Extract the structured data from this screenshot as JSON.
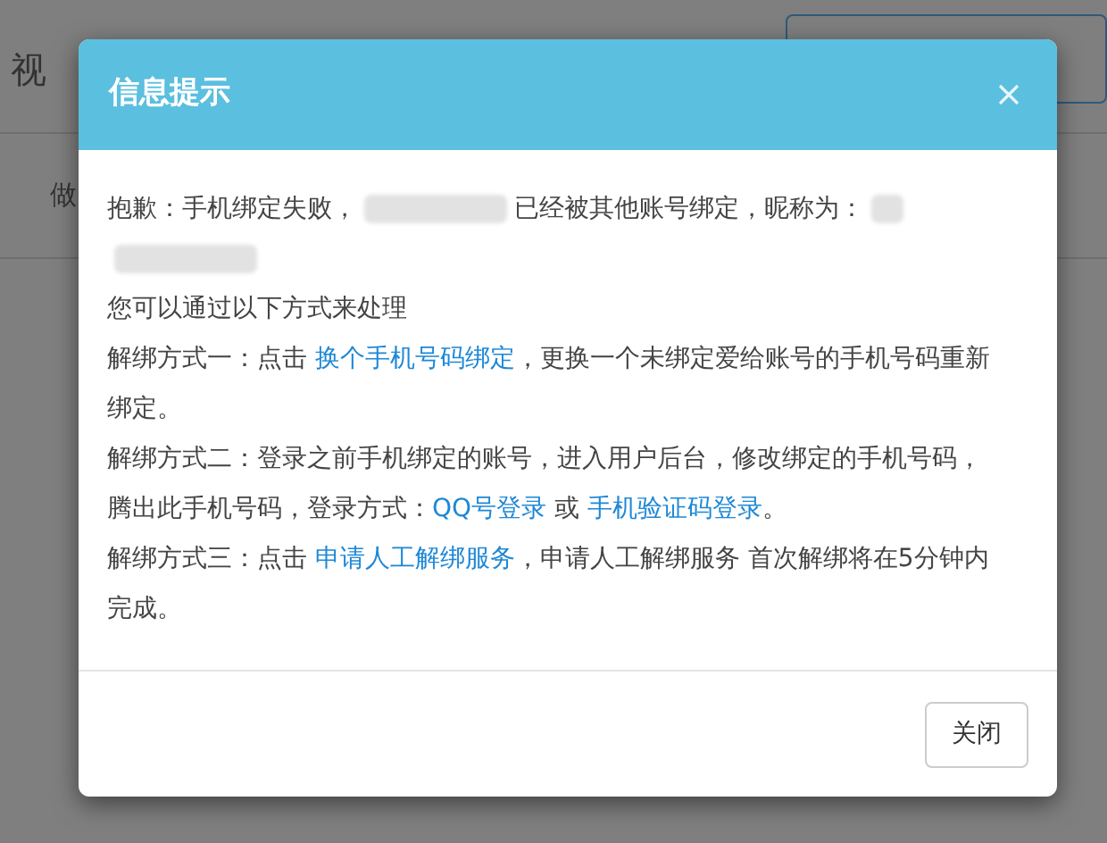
{
  "background": {
    "heading": "视",
    "row_label": "做"
  },
  "dialog": {
    "title": "信息提示",
    "paragraphs": [
      [
        {
          "kind": "text",
          "text": "抱歉：手机绑定失败，"
        },
        {
          "kind": "redacted_long"
        },
        {
          "kind": "text",
          "text": "已经被其他账号绑定，昵称为："
        },
        {
          "kind": "redacted_short"
        },
        {
          "kind": "redacted_long"
        }
      ],
      [
        {
          "kind": "text",
          "text": "您可以通过以下方式来处理"
        }
      ],
      [
        {
          "kind": "text",
          "text": "解绑方式一：点击 "
        },
        {
          "kind": "link",
          "text": "换个手机号码绑定"
        },
        {
          "kind": "text",
          "text": "，更换一个未绑定爱给账号的手机号码重新绑定。"
        }
      ],
      [
        {
          "kind": "text",
          "text": "解绑方式二：登录之前手机绑定的账号，进入用户后台，修改绑定的手机号码，腾出此手机号码，登录方式："
        },
        {
          "kind": "link",
          "text": "QQ号登录"
        },
        {
          "kind": "text",
          "text": " 或 "
        },
        {
          "kind": "link",
          "text": "手机验证码登录"
        },
        {
          "kind": "text",
          "text": "。"
        }
      ],
      [
        {
          "kind": "text",
          "text": "解绑方式三：点击 "
        },
        {
          "kind": "link",
          "text": "申请人工解绑服务"
        },
        {
          "kind": "text",
          "text": "，申请人工解绑服务 首次解绑将在5分钟内完成。"
        }
      ]
    ],
    "buttons": [
      "关闭"
    ]
  }
}
